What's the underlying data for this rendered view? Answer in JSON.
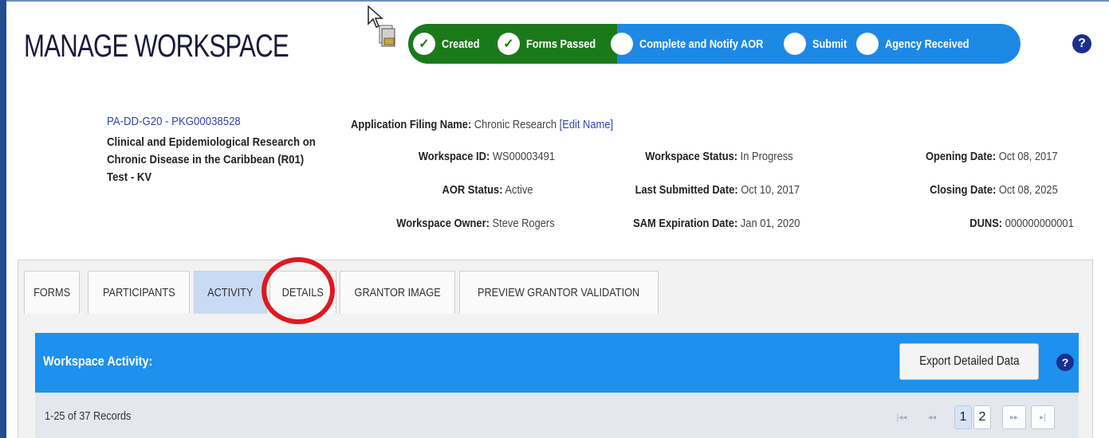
{
  "page": {
    "title": "MANAGE WORKSPACE"
  },
  "progress": {
    "steps": [
      {
        "label": "Created",
        "state": "done"
      },
      {
        "label": "Forms Passed",
        "state": "done"
      },
      {
        "label": "Complete and Notify AOR",
        "state": "pending"
      },
      {
        "label": "Submit",
        "state": "pending"
      },
      {
        "label": "Agency Received",
        "state": "pending"
      }
    ],
    "done_color": "#1a7a1a",
    "pending_color": "#1e88e5"
  },
  "help_label": "?",
  "package": {
    "id_link": "PA-DD-G20 - PKG00038528",
    "title": "Clinical and Epidemiological Research on Chronic Disease in the Caribbean (R01) Test - KV"
  },
  "filing": {
    "label": "Application Filing Name:",
    "value": "Chronic Research",
    "edit_link": "[Edit Name]"
  },
  "details": {
    "workspace_id": {
      "label": "Workspace ID:",
      "value": "WS00003491"
    },
    "aor_status": {
      "label": "AOR Status:",
      "value": "Active"
    },
    "workspace_owner": {
      "label": "Workspace Owner:",
      "value": "Steve Rogers"
    },
    "workspace_status": {
      "label": "Workspace Status:",
      "value": "In Progress"
    },
    "last_submitted": {
      "label": "Last Submitted Date:",
      "value": "Oct 10, 2017"
    },
    "sam_expiration": {
      "label": "SAM Expiration Date:",
      "value": "Jan 01, 2020"
    },
    "opening_date": {
      "label": "Opening Date:",
      "value": "Oct 08, 2017"
    },
    "closing_date": {
      "label": "Closing Date:",
      "value": "Oct 08, 2025"
    },
    "duns": {
      "label": "DUNS:",
      "value": "000000000001"
    }
  },
  "tabs": [
    {
      "label": "FORMS"
    },
    {
      "label": "PARTICIPANTS"
    },
    {
      "label": "ACTIVITY",
      "active": true
    },
    {
      "label": "DETAILS"
    },
    {
      "label": "GRANTOR IMAGE"
    },
    {
      "label": "PREVIEW GRANTOR VALIDATION"
    }
  ],
  "activity": {
    "title": "Workspace Activity:",
    "export_label": "Export Detailed Data",
    "records_text": "1-25 of 37 Records",
    "pager": {
      "first": "|◂◂",
      "prev": "◂◂",
      "pages": [
        "1",
        "2"
      ],
      "current_page": "1",
      "next": "▸▸",
      "last": "▸|"
    }
  },
  "colors": {
    "panel_header": "#1e90ee",
    "help_icon": "#1a2f8f",
    "highlight_circle": "#e0181f",
    "active_tab": "#c9daf5"
  }
}
